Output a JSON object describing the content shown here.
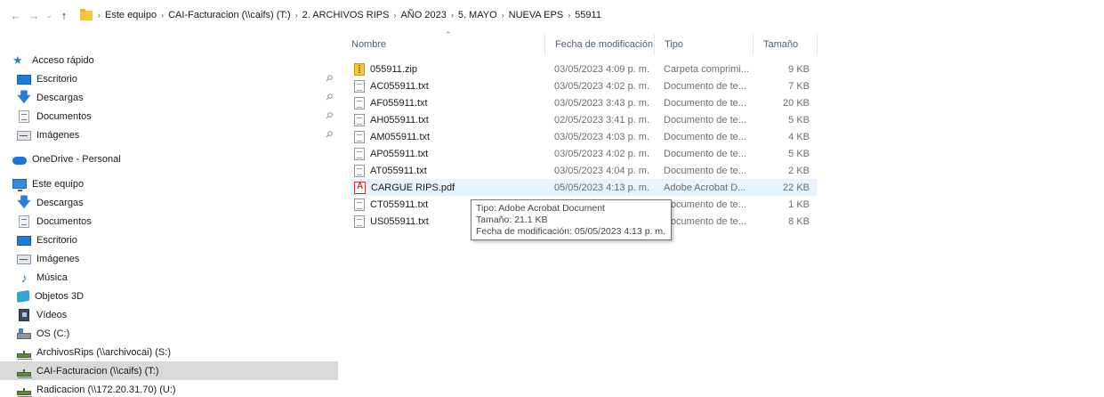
{
  "addressbar": {
    "back_icon": "back-arrow-icon",
    "forward_icon": "forward-arrow-icon",
    "recent_icon": "chevron-down-icon",
    "up_icon": "up-arrow-icon",
    "crumbs": [
      "Este equipo",
      "CAI-Facturacion (\\\\caifs) (T:)",
      "2. ARCHIVOS RIPS",
      "AÑO 2023",
      "5. MAYO",
      "NUEVA EPS",
      "55911"
    ]
  },
  "sidebar": {
    "items": [
      {
        "label": "Acceso rápido",
        "icon": "star-icon",
        "pinned": false
      },
      {
        "label": "Escritorio",
        "icon": "desktop-icon",
        "pinned": true
      },
      {
        "label": "Descargas",
        "icon": "download-icon",
        "pinned": true
      },
      {
        "label": "Documentos",
        "icon": "documents-icon",
        "pinned": true
      },
      {
        "label": "Imágenes",
        "icon": "pictures-icon",
        "pinned": true
      },
      {
        "label": "OneDrive - Personal",
        "icon": "cloud-icon",
        "pinned": false
      },
      {
        "label": "Este equipo",
        "icon": "computer-icon",
        "pinned": false
      },
      {
        "label": "Descargas",
        "icon": "download-icon",
        "pinned": false
      },
      {
        "label": "Documentos",
        "icon": "documents-icon",
        "pinned": false
      },
      {
        "label": "Escritorio",
        "icon": "desktop-icon",
        "pinned": false
      },
      {
        "label": "Imágenes",
        "icon": "pictures-icon",
        "pinned": false
      },
      {
        "label": "Música",
        "icon": "music-icon",
        "pinned": false
      },
      {
        "label": "Objetos 3D",
        "icon": "3d-objects-icon",
        "pinned": false
      },
      {
        "label": "Vídeos",
        "icon": "videos-icon",
        "pinned": false
      },
      {
        "label": "OS (C:)",
        "icon": "drive-icon",
        "pinned": false
      },
      {
        "label": "ArchivosRips (\\\\archivocai) (S:)",
        "icon": "network-drive-icon",
        "pinned": false
      },
      {
        "label": "CAI-Facturacion (\\\\caifs) (T:)",
        "icon": "network-drive-icon",
        "pinned": false,
        "selected": true
      },
      {
        "label": "Radicacion (\\\\172.20.31.70) (U:)",
        "icon": "network-drive-icon",
        "pinned": false
      }
    ]
  },
  "filelist": {
    "columns": {
      "name": "Nombre",
      "modified": "Fecha de modificación",
      "type": "Tipo",
      "size": "Tamaño"
    },
    "sorted_by": "Nombre",
    "files": [
      {
        "name": "055911.zip",
        "date": "03/05/2023 4:09 p. m.",
        "type": "Carpeta comprimi...",
        "size": "9 KB",
        "icon": "zip-icon"
      },
      {
        "name": "AC055911.txt",
        "date": "03/05/2023 4:02 p. m.",
        "type": "Documento de te...",
        "size": "7 KB",
        "icon": "text-file-icon"
      },
      {
        "name": "AF055911.txt",
        "date": "03/05/2023 3:43 p. m.",
        "type": "Documento de te...",
        "size": "20 KB",
        "icon": "text-file-icon"
      },
      {
        "name": "AH055911.txt",
        "date": "02/05/2023 3:41 p. m.",
        "type": "Documento de te...",
        "size": "5 KB",
        "icon": "text-file-icon"
      },
      {
        "name": "AM055911.txt",
        "date": "03/05/2023 4:03 p. m.",
        "type": "Documento de te...",
        "size": "4 KB",
        "icon": "text-file-icon"
      },
      {
        "name": "AP055911.txt",
        "date": "03/05/2023 4:02 p. m.",
        "type": "Documento de te...",
        "size": "5 KB",
        "icon": "text-file-icon"
      },
      {
        "name": "AT055911.txt",
        "date": "03/05/2023 4:04 p. m.",
        "type": "Documento de te...",
        "size": "2 KB",
        "icon": "text-file-icon"
      },
      {
        "name": "CARGUE RIPS.pdf",
        "date": "05/05/2023 4:13 p. m.",
        "type": "Adobe Acrobat D...",
        "size": "22 KB",
        "icon": "pdf-icon",
        "hover": true
      },
      {
        "name": "CT055911.txt",
        "date": "",
        "type": "Documento de te...",
        "size": "1 KB",
        "icon": "text-file-icon"
      },
      {
        "name": "US055911.txt",
        "date": "",
        "type": "Documento de te...",
        "size": "8 KB",
        "icon": "text-file-icon"
      }
    ]
  },
  "tooltip": {
    "type_line": "Tipo: Adobe Acrobat Document",
    "size_line": "Tamaño: 21.1 KB",
    "date_line": "Fecha de modificación: 05/05/2023 4:13 p. m."
  },
  "colors": {
    "hover_row": "#e5f3ff",
    "selected_nav": "#d9d9d9",
    "header_text": "#4c607a",
    "secondary_text": "#6d6d6d"
  }
}
